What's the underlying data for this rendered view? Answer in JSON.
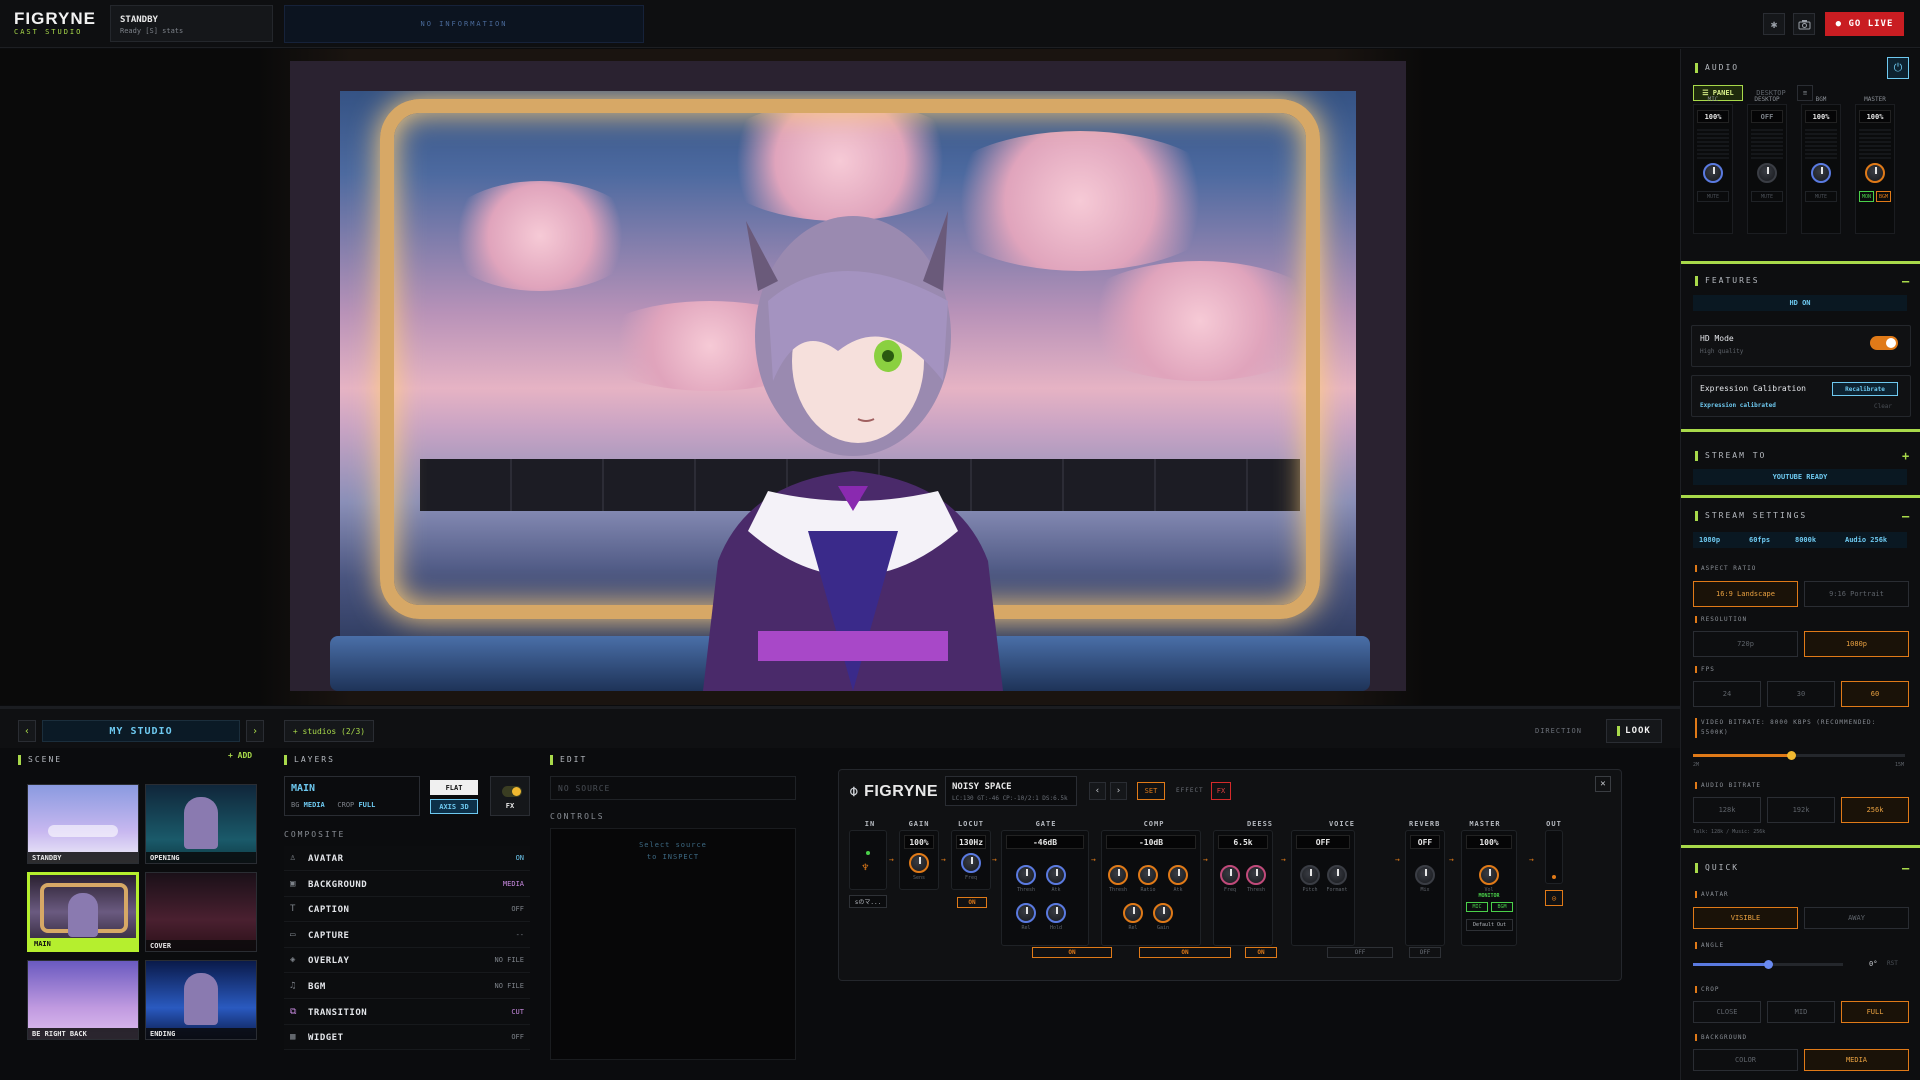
{
  "app": {
    "name": "FIGRYNE",
    "subtitle": "CAST STUDIO"
  },
  "topbar": {
    "scene_name": "STANDBY",
    "scene_status": "Ready [S] stats",
    "info_text": "NO INFORMATION",
    "go_live_label": "● GO LIVE",
    "accent_color": "#a8d94a",
    "live_color": "#c91d22"
  },
  "direction_bar": {
    "studio_name": "MY STUDIO",
    "studios_label": "+ studios (2/3)",
    "direction_label": "DIRECTION",
    "look_label": "LOOK"
  },
  "scene_panel": {
    "title": "SCENE",
    "add_label": "+ ADD",
    "scenes": [
      {
        "label": "STANDBY",
        "active": false
      },
      {
        "label": "OPENING",
        "active": false
      },
      {
        "label": "MAIN",
        "active": true
      },
      {
        "label": "COVER",
        "active": false
      },
      {
        "label": "BE RIGHT BACK",
        "active": false
      },
      {
        "label": "ENDING",
        "active": false
      }
    ]
  },
  "layers_panel": {
    "title": "LAYERS",
    "main_name": "MAIN",
    "bg_label": "BG",
    "bg_value": "MEDIA",
    "crop_label": "CROP",
    "crop_value": "FULL",
    "flat_label": "FLAT",
    "axis_label": "AXIS 3D",
    "fx_label": "FX",
    "composite_label": "COMPOSITE",
    "rows": [
      {
        "name": "AVATAR",
        "value": "ON",
        "icon": "person-icon",
        "value_color": "#6ec9f0"
      },
      {
        "name": "BACKGROUND",
        "value": "MEDIA",
        "icon": "image-icon",
        "value_color": "#c88ae0"
      },
      {
        "name": "CAPTION",
        "value": "OFF",
        "icon": "text-icon",
        "value_color": "#7d8289"
      },
      {
        "name": "CAPTURE",
        "value": "--",
        "icon": "monitor-icon",
        "value_color": "#7d8289"
      },
      {
        "name": "OVERLAY",
        "value": "NO FILE",
        "icon": "layers-icon",
        "value_color": "#7d8289"
      },
      {
        "name": "BGM",
        "value": "NO FILE",
        "icon": "music-icon",
        "value_color": "#7d8289"
      },
      {
        "name": "TRANSITION",
        "value": "CUT",
        "icon": "transition-icon",
        "value_color": "#c88ae0"
      },
      {
        "name": "WIDGET",
        "value": "OFF",
        "icon": "widget-icon",
        "value_color": "#7d8289"
      }
    ]
  },
  "edit_panel": {
    "title": "EDIT",
    "no_source": "NO SOURCE",
    "controls_label": "CONTROLS",
    "select_line1": "Select source",
    "select_line2": "to INSPECT"
  },
  "fx_panel": {
    "logo": "FIGRYNE",
    "preset_name": "NOISY SPACE",
    "preset_meta": "LC:130 GT:-46 CP:-10/2:1 DS:6.5k",
    "set_label": "SET",
    "effect_label": "EFFECT",
    "fx_label": "FX",
    "in_label": "IN",
    "in_source": "sのマ...",
    "out_label": "OUT",
    "modules": [
      {
        "name": "GAIN",
        "value": "100%",
        "knobs": [
          "Sens"
        ]
      },
      {
        "name": "LOCUT",
        "value": "130Hz",
        "knobs": [
          "Freq"
        ],
        "state": "ON"
      },
      {
        "name": "GATE",
        "value": "-46dB",
        "knobs": [
          "Thresh",
          "Atk",
          "Rel",
          "Hold"
        ],
        "state": "ON"
      },
      {
        "name": "COMP",
        "value": "-10dB",
        "knobs": [
          "Thresh",
          "Ratio",
          "Atk",
          "Rel",
          "Gain"
        ],
        "state": "ON"
      },
      {
        "name": "DEESS",
        "value": "6.5k",
        "knobs": [
          "Freq",
          "Thresh"
        ],
        "state": "ON"
      },
      {
        "name": "VOICE",
        "value": "OFF",
        "knobs": [
          "Pitch",
          "Formant"
        ],
        "state": "OFF"
      },
      {
        "name": "REVERB",
        "value": "OFF",
        "knobs": [
          "Mix"
        ],
        "state": "OFF"
      },
      {
        "name": "MASTER",
        "value": "100%",
        "knobs": [
          "Vol"
        ],
        "monitor": "MONITOR",
        "mic": "MIC",
        "bgm": "BGM",
        "out_device": "Default Out"
      }
    ]
  },
  "right_panel": {
    "audio": {
      "title": "AUDIO",
      "panel_label": "PANEL",
      "desktop_label": "DESKTOP",
      "channels": [
        {
          "name": "MIC",
          "value": "100%",
          "mute": "MUTE"
        },
        {
          "name": "DESKTOP",
          "value": "OFF",
          "mute": "MUTE"
        },
        {
          "name": "BGM",
          "value": "100%",
          "mute": "MUTE"
        },
        {
          "name": "MASTER",
          "value": "100%",
          "mon": "MON",
          "bgm": "BGM"
        }
      ]
    },
    "features": {
      "title": "FEATURES",
      "hd_status": "HD ON",
      "hd_mode_label": "HD Mode",
      "hd_mode_sub": "High quality",
      "hd_mode_on": true,
      "calib_label": "Expression Calibration",
      "calib_button": "Recalibrate",
      "calib_status": "Expression calibrated",
      "clear_label": "Clear"
    },
    "stream_to": {
      "title": "STREAM TO",
      "status": "YOUTUBE READY"
    },
    "stream_settings": {
      "title": "STREAM SETTINGS",
      "summary": [
        "1080p",
        "60fps",
        "8000k",
        "Audio 256k"
      ],
      "aspect_label": "ASPECT RATIO",
      "aspect_options": [
        {
          "label": "16:9 Landscape",
          "on": true
        },
        {
          "label": "9:16 Portrait",
          "on": false
        }
      ],
      "resolution_label": "RESOLUTION",
      "resolution_options": [
        {
          "label": "720p",
          "on": false
        },
        {
          "label": "1080p",
          "on": true
        }
      ],
      "fps_label": "FPS",
      "fps_options": [
        {
          "label": "24",
          "on": false
        },
        {
          "label": "30",
          "on": false
        },
        {
          "label": "60",
          "on": true
        }
      ],
      "bitrate_label": "VIDEO BITRATE: 8000 KBPS (RECOMMENDED: 5500K)",
      "bitrate_min": "2M",
      "bitrate_max": "15M",
      "bitrate_fraction": 0.46,
      "audio_bitrate_label": "AUDIO BITRATE",
      "audio_options": [
        {
          "label": "128k",
          "on": false
        },
        {
          "label": "192k",
          "on": false
        },
        {
          "label": "256k",
          "on": true
        }
      ],
      "audio_note": "Talk: 128k / Music: 256k"
    },
    "quick": {
      "title": "QUICK",
      "avatar_label": "AVATAR",
      "avatar_options": [
        {
          "label": "VISIBLE",
          "on": true
        },
        {
          "label": "AWAY",
          "on": false
        }
      ],
      "angle_label": "ANGLE",
      "angle_value": "0°",
      "angle_reset": "RST",
      "angle_fraction": 0.5,
      "crop_label": "CROP",
      "crop_options": [
        {
          "label": "CLOSE",
          "on": false
        },
        {
          "label": "MID",
          "on": false
        },
        {
          "label": "FULL",
          "on": true
        }
      ],
      "background_label": "BACKGROUND",
      "background_options": [
        {
          "label": "COLOR",
          "on": false
        },
        {
          "label": "MEDIA",
          "on": true
        }
      ]
    }
  }
}
